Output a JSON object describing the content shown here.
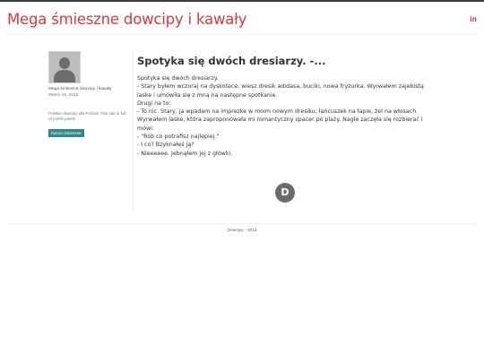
{
  "header": {
    "site_title": "Mega śmieszne dowcipy i kawały",
    "social_icon": "linkedin-icon",
    "social_label": "in"
  },
  "sidebar": {
    "avatar_icon": "default-user-avatar",
    "author": "Mega śmieszne dowcipy i kawały",
    "date": "March 16, 2016",
    "description": "Polskie dowcipy dla Polonii! This site is full of polish jokes!",
    "tag": "humor śmieszne"
  },
  "post": {
    "title": "Spotyka się dwóch dresiarzy. -...",
    "lines": [
      "Spotyka się dwóch dresiarzy.",
      "- Stary byłem wczoraj na dyskotece, wiesz dresik adidasa, buciki, nowa fryzurka. Wyrwałem zajebistą",
      "laske i umówiła się z mną na następne spotkanie.",
      "Drugi na to:",
      "- To nic. Stary, ja wpadam na imprezke w moim nowym dresiku, łańcuszek na łapie, żel na włosach.",
      "Wyrwałem laske, która zaproponowała mi romantyczny spacer po plaży. Nagle zaczęła się rozbierać i",
      "mówi:",
      "- \"Rób co potrafisz najlepiej.\"",
      "- I co? Bzyknałeś ją?",
      "- Nieeeeee. Jebnąłem jej z główki."
    ]
  },
  "comments": {
    "icon": "disqus-icon",
    "label": "D"
  },
  "footer": {
    "text": "Dowcipy - 2014"
  },
  "colors": {
    "brand": "#d23a3e",
    "tag_bg": "#2e8b8b"
  }
}
